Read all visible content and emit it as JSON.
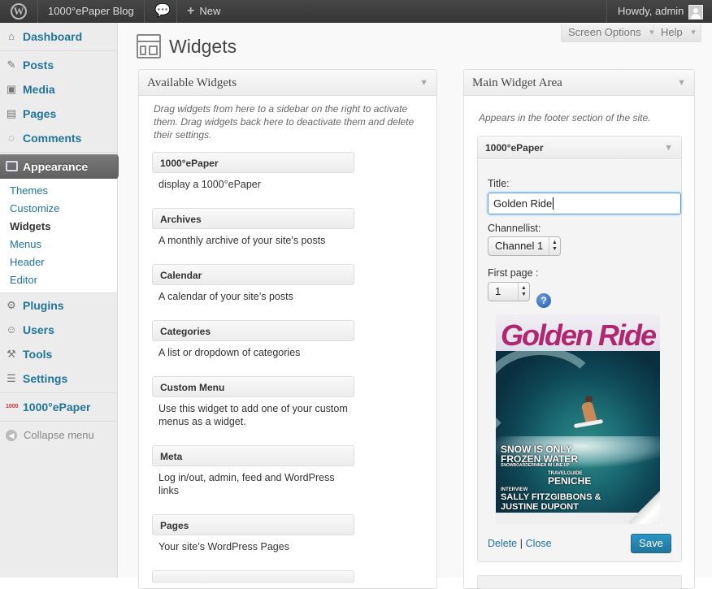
{
  "admin_bar": {
    "site_name": "1000°ePaper Blog",
    "new_label": "New",
    "howdy": "Howdy, admin"
  },
  "sidebar": {
    "items": [
      {
        "label": "Dashboard",
        "icon": "home-icon"
      },
      {
        "label": "Posts",
        "icon": "pin-icon"
      },
      {
        "label": "Media",
        "icon": "media-icon"
      },
      {
        "label": "Pages",
        "icon": "pages-icon"
      },
      {
        "label": "Comments",
        "icon": "comment-icon"
      }
    ],
    "current": {
      "label": "Appearance",
      "icon": "appearance-icon"
    },
    "submenu": [
      "Themes",
      "Customize",
      "Widgets",
      "Menus",
      "Header",
      "Editor"
    ],
    "submenu_current": "Widgets",
    "items2": [
      {
        "label": "Plugins",
        "icon": "plugin-icon"
      },
      {
        "label": "Users",
        "icon": "users-icon"
      },
      {
        "label": "Tools",
        "icon": "tools-icon"
      },
      {
        "label": "Settings",
        "icon": "settings-icon"
      }
    ],
    "epaper": {
      "label": "1000°ePaper",
      "icon": "epaper-icon"
    },
    "collapse": "Collapse menu"
  },
  "header": {
    "title": "Widgets",
    "screen_options": "Screen Options",
    "help": "Help"
  },
  "available": {
    "title": "Available Widgets",
    "description": "Drag widgets from here to a sidebar on the right to activate them. Drag widgets back here to deactivate them and delete their settings.",
    "widgets": [
      {
        "name": "1000°ePaper",
        "desc": "display a 1000°ePaper"
      },
      {
        "name": "Archives",
        "desc": "A monthly archive of your site’s posts"
      },
      {
        "name": "Calendar",
        "desc": "A calendar of your site’s posts"
      },
      {
        "name": "Categories",
        "desc": "A list or dropdown of categories"
      },
      {
        "name": "Custom Menu",
        "desc": "Use this widget to add one of your custom menus as a widget."
      },
      {
        "name": "Meta",
        "desc": "Log in/out, admin, feed and WordPress links"
      },
      {
        "name": "Pages",
        "desc": "Your site’s WordPress Pages"
      }
    ]
  },
  "main_area": {
    "title": "Main Widget Area",
    "description": "Appears in the footer section of the site.",
    "widget": {
      "name": "1000°ePaper",
      "title_label": "Title:",
      "title_value": "Golden Ride",
      "channel_label": "Channellist:",
      "channel_value": "Channel 1",
      "first_page_label": "First page :",
      "first_page_value": "1",
      "help_icon": "question-icon",
      "cover": {
        "masthead": "Golden Ride",
        "headline1": "SNOW IS ONLY",
        "headline2": "FROZEN WATER",
        "headline3": "SNOWBOARDERINNEN IM LINE-UP",
        "travel_kicker": "TRAVELGUIDE",
        "travel_title": "PENICHE",
        "interview_kicker": "INTERVIEW",
        "interview_title1": "SALLY FITZGIBBONS &",
        "interview_title2": "JUSTINE DUPONT"
      },
      "delete_label": "Delete",
      "separator": "|",
      "close_label": "Close",
      "save_label": "Save"
    }
  },
  "colors": {
    "accent": "#21759b",
    "admin_bar": "#464646",
    "current_menu": "#6d6d6d"
  }
}
